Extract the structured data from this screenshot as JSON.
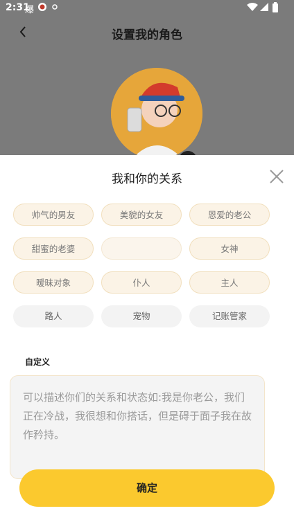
{
  "status": {
    "time": "2:31",
    "icons": [
      "app-notification-icon",
      "app-notification-icon-2",
      "notification-dot-icon",
      "wifi-icon",
      "signal-icon",
      "battery-icon"
    ]
  },
  "header": {
    "title": "设置我的角色"
  },
  "sheet": {
    "title": "我和你的关系",
    "relations": [
      {
        "label": "帅气的男友",
        "style": "sel"
      },
      {
        "label": "美貌的女友",
        "style": "sel"
      },
      {
        "label": "恩爱的老公",
        "style": "sel"
      },
      {
        "label": "甜蜜的老婆",
        "style": "sel"
      },
      {
        "label": "",
        "style": "blank"
      },
      {
        "label": "女神",
        "style": "sel"
      },
      {
        "label": "暧昧对象",
        "style": "sel"
      },
      {
        "label": "仆人",
        "style": "sel"
      },
      {
        "label": "主人",
        "style": "sel"
      },
      {
        "label": "路人",
        "style": "plain"
      },
      {
        "label": "宠物",
        "style": "plain"
      },
      {
        "label": "记账管家",
        "style": "plain"
      }
    ],
    "custom_label": "自定义",
    "custom_placeholder": "可以描述你们的关系和状态如:我是你老公，我们正在冷战，我很想和你搭话，但是碍于面子我在故作矜持。",
    "confirm_label": "确定"
  },
  "colors": {
    "accent": "#fbc92e",
    "overlay": "#7b7b7b"
  }
}
